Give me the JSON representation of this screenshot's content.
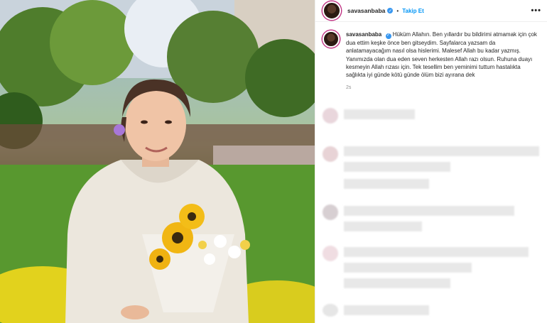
{
  "post": {
    "username": "savasanbaba",
    "follow_label": "Takip Et",
    "dot": "•",
    "verified_icon": "verified-badge-icon",
    "more_icon": "•••",
    "caption_username": "savasanbaba",
    "caption": "Hüküm Allahın. Ben yıllardır bu bildirimi atmamak için çok dua ettim keşke önce ben gitseydim. Sayfalarca yazsam da anlatamayacağım nasıl olsa hislerimi. Malesef Allah bu kadar yazmış. Yanımızda olan dua eden seven herkesten Allah razı olsun. Ruhuna duayı kesmeyin Allah rızası için. Tek tesellim ben yeminimi tuttum hastalıkta sağlıkta iyi günde kötü günde ölüm bizi ayırana dek",
    "time": "2s"
  },
  "colors": {
    "link": "#0095f6",
    "verified": "#3897f0"
  }
}
